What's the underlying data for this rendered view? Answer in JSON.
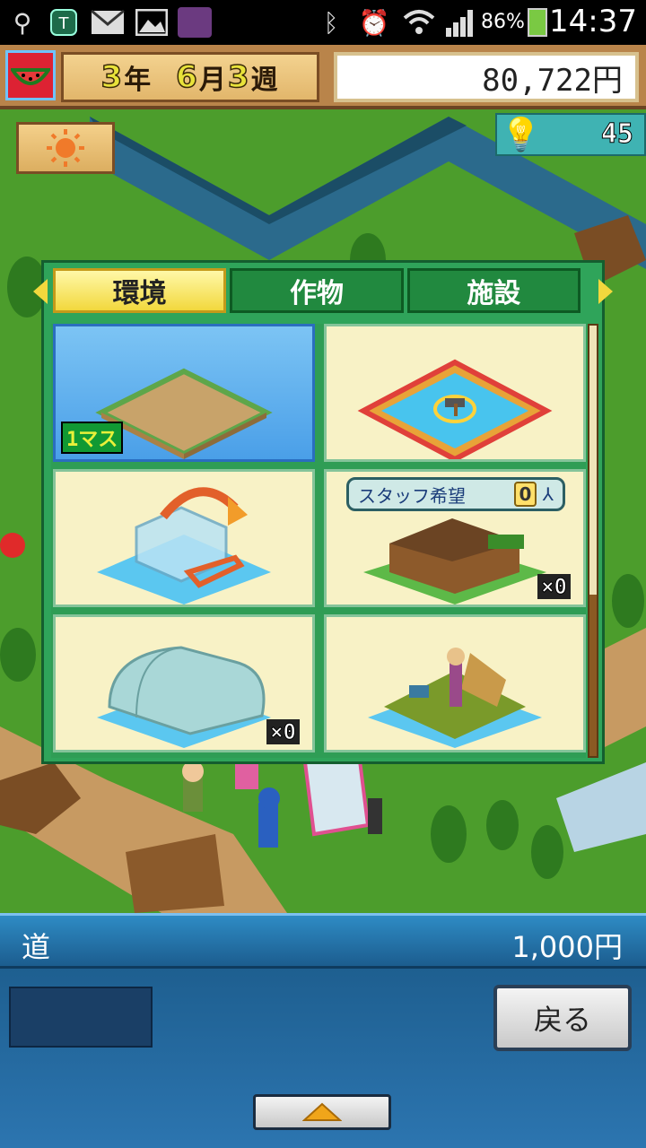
{
  "status_bar": {
    "time": "14:37",
    "battery": "86%",
    "icons": [
      "usb-icon",
      "shield-app-icon",
      "mail-icon",
      "gallery-icon",
      "game-app-icon",
      "bluetooth-icon",
      "alarm-icon",
      "wifi-icon",
      "signal-icon",
      "battery-icon"
    ]
  },
  "hud": {
    "date": {
      "year": "3",
      "year_unit": "年",
      "month": "6",
      "month_unit": "月",
      "week": "3",
      "week_unit": "週"
    },
    "money": "80,722円",
    "research_points": "45",
    "weather": "sunny-icon"
  },
  "panel": {
    "tabs": [
      {
        "label": "環境",
        "active": true
      },
      {
        "label": "作物",
        "active": false
      },
      {
        "label": "施設",
        "active": false
      }
    ],
    "items": [
      {
        "icon": "road-tile-icon",
        "badge": "1マス",
        "selected": true
      },
      {
        "icon": "pond-tile-icon",
        "badge": "",
        "selected": false
      },
      {
        "icon": "move-building-icon",
        "badge": "",
        "selected": false
      },
      {
        "icon": "farmhouse-icon",
        "qty": "×0",
        "staff_label": "スタッフ希望",
        "staff_count": "0",
        "selected": false
      },
      {
        "icon": "greenhouse-icon",
        "qty": "×0",
        "selected": false
      },
      {
        "icon": "scarecrow-field-icon",
        "badge": "",
        "selected": false
      }
    ]
  },
  "info_bar": {
    "name": "道",
    "price": "1,000円"
  },
  "controls": {
    "back_label": "戻る"
  },
  "colors": {
    "panel_green": "#2fa45a",
    "tab_active": "#f2d83d",
    "selected_blue": "#4a9fe8",
    "info_bar_blue": "#2e8bc4"
  }
}
